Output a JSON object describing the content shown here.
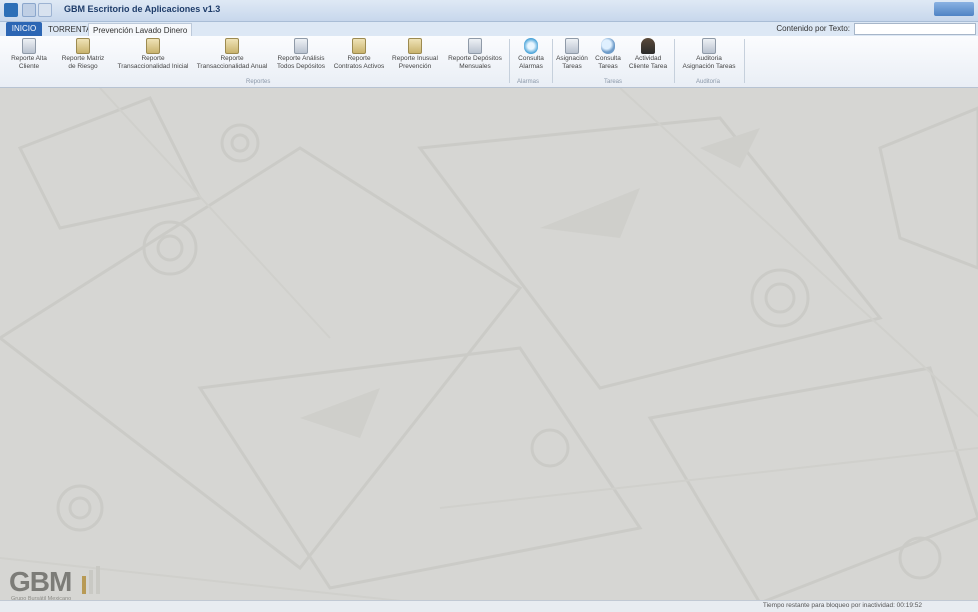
{
  "window": {
    "title": "GBM Escritorio de Aplicaciones v1.3"
  },
  "tabs": {
    "file": "INICIO",
    "items": [
      "TORRENTA",
      "Prevención Lavado Dinero"
    ]
  },
  "search": {
    "label": "Contenido por Texto:",
    "value": ""
  },
  "ribbon": {
    "buttons": [
      {
        "label": "Reporte Alta\nCliente",
        "icon": "report-icon"
      },
      {
        "label": "Reporte Matriz\nde Riesgo",
        "icon": "report-icon"
      },
      {
        "label": "Reporte\nTransaccionalidad Inicial",
        "icon": "report-icon"
      },
      {
        "label": "Reporte\nTransaccionalidad Anual",
        "icon": "report-icon"
      },
      {
        "label": "Reporte Análisis\nTodos Depósitos",
        "icon": "report-icon"
      },
      {
        "label": "Reporte\nContratos Activos",
        "icon": "report-icon"
      },
      {
        "label": "Reporte Inusual\nPrevención",
        "icon": "report-icon"
      },
      {
        "label": "Reporte Depósitos\nMensuales",
        "icon": "report-icon"
      },
      {
        "label": "Consulta\nAlarmas",
        "icon": "alarm-icon"
      },
      {
        "label": "Asignación\nTareas",
        "icon": "task-icon"
      },
      {
        "label": "Consulta\nTareas",
        "icon": "search-icon"
      },
      {
        "label": "Actividad\nCliente Tarea",
        "icon": "user-icon"
      },
      {
        "label": "Auditoria\nAsignación Tareas",
        "icon": "audit-icon"
      }
    ],
    "groups": [
      "Reportes",
      "Alarmas",
      "Tareas",
      "Auditoría"
    ]
  },
  "logo": {
    "text": "GBM",
    "sub": "Grupo Bursátil Mexicano"
  },
  "status": {
    "text": "Tiempo restante para bloqueo por inactividad: 00:19:52"
  },
  "colors": {
    "accent": "#2c66b4",
    "canvas": "#d6d6d3"
  }
}
